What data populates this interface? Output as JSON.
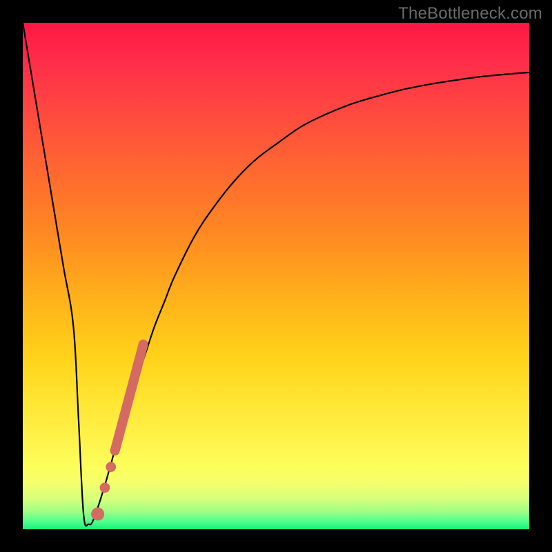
{
  "watermark": "TheBottleneck.com",
  "chart_data": {
    "type": "line",
    "title": "",
    "xlabel": "",
    "ylabel": "",
    "xlim": [
      0,
      100
    ],
    "ylim": [
      0,
      100
    ],
    "grid": false,
    "series": [
      {
        "name": "curve",
        "color": "#000000",
        "x": [
          0,
          2,
          4,
          6,
          8,
          10,
          11,
          12,
          13,
          14,
          16,
          18,
          20,
          22,
          24,
          26,
          28,
          30,
          34,
          38,
          42,
          46,
          50,
          55,
          60,
          65,
          70,
          75,
          80,
          85,
          90,
          95,
          100
        ],
        "y": [
          100,
          88,
          76,
          64,
          52,
          40,
          22,
          3,
          1,
          2,
          8,
          15,
          22,
          28,
          34,
          40,
          45,
          50,
          58,
          64,
          69,
          73,
          76,
          79.5,
          82,
          84,
          85.5,
          86.8,
          87.8,
          88.6,
          89.3,
          89.8,
          90.2
        ]
      }
    ],
    "markers": [
      {
        "name": "highlight-segment",
        "shape": "thick-line",
        "color": "#d46a62",
        "x": [
          18.2,
          23.8
        ],
        "y": [
          15.5,
          36.5
        ]
      },
      {
        "name": "dot-mid",
        "shape": "circle",
        "color": "#d46a62",
        "x": 17.4,
        "y": 12.3,
        "r": 1.0
      },
      {
        "name": "dot-lower",
        "shape": "circle",
        "color": "#d46a62",
        "x": 16.2,
        "y": 8.2,
        "r": 1.0
      },
      {
        "name": "dot-lowest",
        "shape": "circle",
        "color": "#d46a62",
        "x": 14.8,
        "y": 3.0,
        "r": 1.3
      }
    ]
  }
}
